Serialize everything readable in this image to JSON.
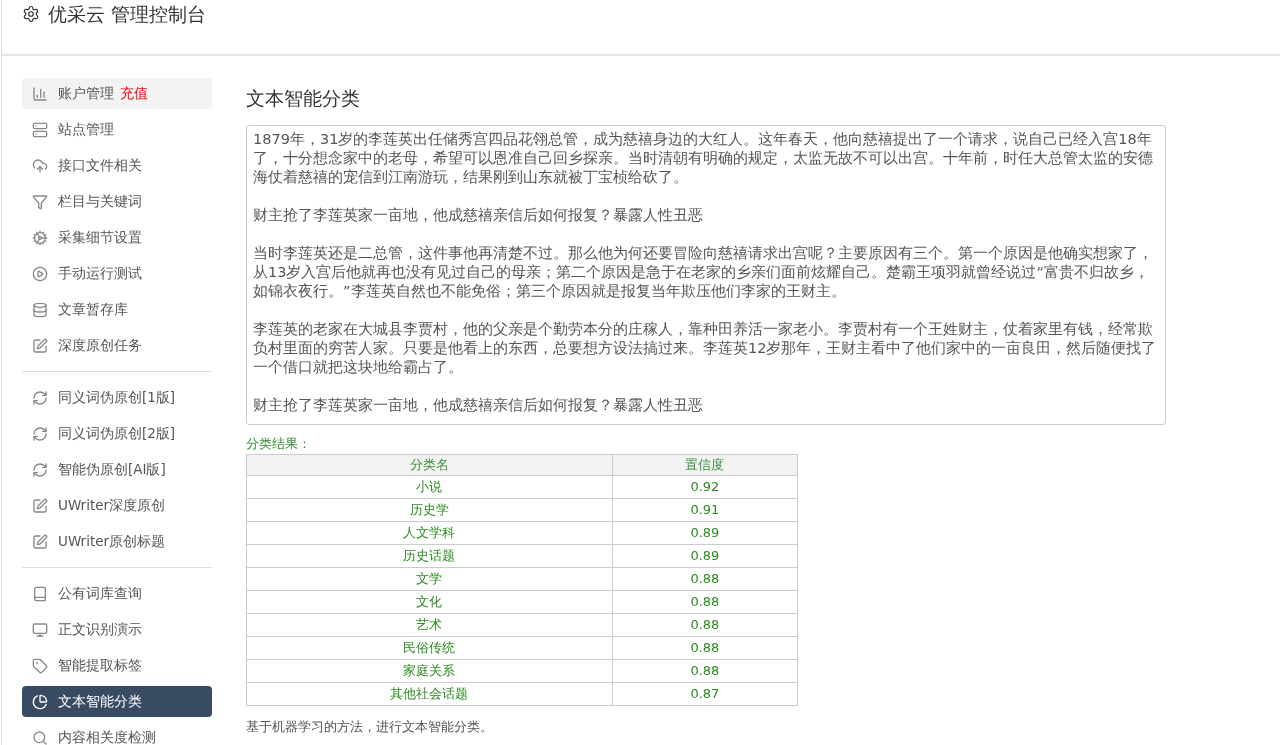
{
  "header": {
    "title": "优采云 管理控制台"
  },
  "sidebar": {
    "groups": [
      {
        "items": [
          {
            "kind": "chart",
            "label": "账户管理",
            "badge": "充值",
            "selected": false,
            "hover": true
          },
          {
            "kind": "server",
            "label": "站点管理",
            "selected": false,
            "hover": false
          },
          {
            "kind": "cloud",
            "label": "接口文件相关",
            "selected": false,
            "hover": false
          },
          {
            "kind": "filter",
            "label": "栏目与关键词",
            "selected": false,
            "hover": false
          },
          {
            "kind": "cogs",
            "label": "采集细节设置",
            "selected": false,
            "hover": false
          },
          {
            "kind": "play",
            "label": "手动运行测试",
            "selected": false,
            "hover": false
          },
          {
            "kind": "database",
            "label": "文章暂存库",
            "selected": false,
            "hover": false
          },
          {
            "kind": "edit",
            "label": "深度原创任务",
            "selected": false,
            "hover": false
          }
        ]
      },
      {
        "items": [
          {
            "kind": "refresh",
            "label": "同义词伪原创[1版]",
            "selected": false,
            "hover": false
          },
          {
            "kind": "refresh",
            "label": "同义词伪原创[2版]",
            "selected": false,
            "hover": false
          },
          {
            "kind": "refresh",
            "label": "智能伪原创[AI版]",
            "selected": false,
            "hover": false
          },
          {
            "kind": "edit",
            "label": "UWriter深度原创",
            "selected": false,
            "hover": false
          },
          {
            "kind": "edit",
            "label": "UWriter原创标题",
            "selected": false,
            "hover": false
          }
        ]
      },
      {
        "items": [
          {
            "kind": "book",
            "label": "公有词库查询",
            "selected": false,
            "hover": false
          },
          {
            "kind": "monitor",
            "label": "正文识别演示",
            "selected": false,
            "hover": false
          },
          {
            "kind": "tag",
            "label": "智能提取标签",
            "selected": false,
            "hover": false
          },
          {
            "kind": "pie",
            "label": "文本智能分类",
            "selected": true,
            "hover": false
          },
          {
            "kind": "search",
            "label": "内容相关度检测",
            "selected": false,
            "hover": false
          }
        ]
      }
    ]
  },
  "main": {
    "title": "文本智能分类",
    "input": {
      "paragraphs": [
        "1879年，31岁的李莲英出任储秀宫四品花翎总管，成为慈禧身边的大红人。这年春天，他向慈禧提出了一个请求，说自己已经入宫18年了，十分想念家中的老母，希望可以恩准自己回乡探亲。当时清朝有明确的规定，太监无故不可以出宫。十年前，时任大总管太监的安德海仗着慈禧的宠信到江南游玩，结果刚到山东就被丁宝桢给砍了。",
        "财主抢了李莲英家一亩地，他成慈禧亲信后如何报复？暴露人性丑恶",
        "当时李莲英还是二总管，这件事他再清楚不过。那么他为何还要冒险向慈禧请求出宫呢？主要原因有三个。第一个原因是他确实想家了，从13岁入宫后他就再也没有见过自己的母亲；第二个原因是急于在老家的乡亲们面前炫耀自己。楚霸王项羽就曾经说过“富贵不归故乡，如锦衣夜行。”李莲英自然也不能免俗；第三个原因就是报复当年欺压他们李家的王财主。",
        "李莲英的老家在大城县李贾村，他的父亲是个勤劳本分的庄稼人，靠种田养活一家老小。李贾村有一个王姓财主，仗着家里有钱，经常欺负村里面的穷苦人家。只要是他看上的东西，总要想方设法搞过来。李莲英12岁那年，王财主看中了他们家中的一亩良田，然后随便找了一个借口就把这块地给霸占了。",
        "财主抢了李莲英家一亩地，他成慈禧亲信后如何报复？暴露人性丑恶"
      ]
    },
    "result_label": "分类结果：",
    "table": {
      "columns": [
        "分类名",
        "置信度"
      ],
      "rows": [
        [
          "小说",
          "0.92"
        ],
        [
          "历史学",
          "0.91"
        ],
        [
          "人文学科",
          "0.89"
        ],
        [
          "历史话题",
          "0.89"
        ],
        [
          "文学",
          "0.88"
        ],
        [
          "文化",
          "0.88"
        ],
        [
          "艺术",
          "0.88"
        ],
        [
          "民俗传统",
          "0.88"
        ],
        [
          "家庭关系",
          "0.88"
        ],
        [
          "其他社会话题",
          "0.87"
        ]
      ]
    },
    "note": "基于机器学习的方法，进行文本智能分类。"
  }
}
